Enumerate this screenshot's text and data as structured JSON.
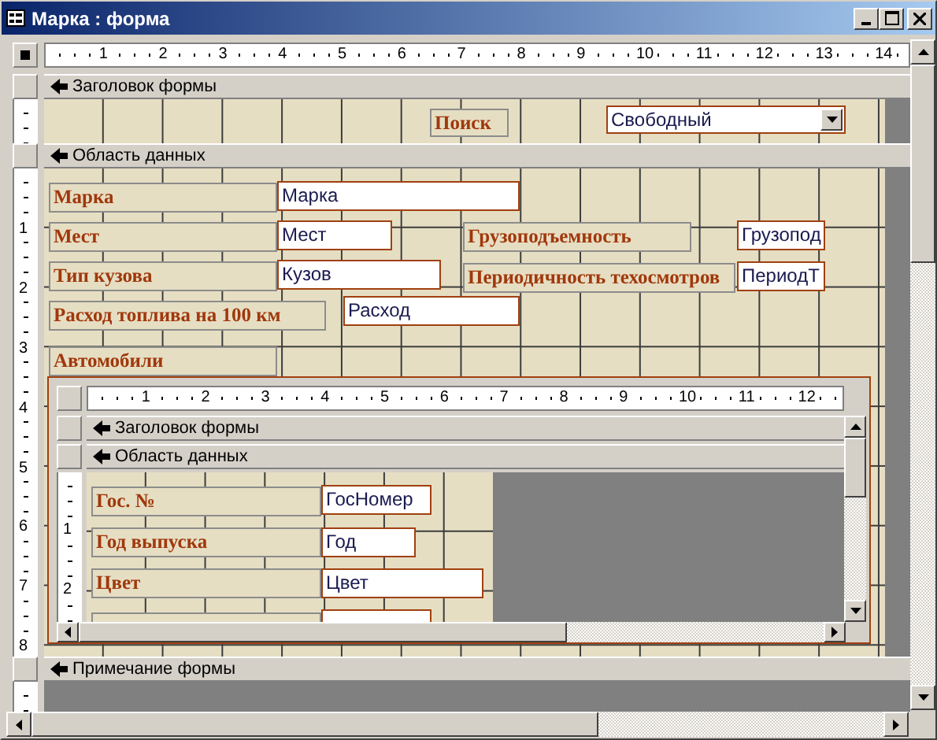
{
  "window": {
    "title": "Марка : форма"
  },
  "ruler": [
    "1",
    "2",
    "3",
    "4",
    "5",
    "6",
    "7",
    "8",
    "9",
    "10",
    "11",
    "12",
    "13",
    "14"
  ],
  "vertical_ruler": [
    "1",
    "2",
    "3",
    "4",
    "5",
    "6",
    "7",
    "8"
  ],
  "form_header": {
    "label": "Заголовок формы",
    "controls": [
      {
        "kind": "label",
        "text": "Поиск"
      },
      {
        "kind": "combo",
        "value": "Свободный"
      }
    ]
  },
  "detail": {
    "label": "Область данных",
    "controls": [
      {
        "kind": "label",
        "text": "Марка"
      },
      {
        "kind": "textbox",
        "text": "Марка"
      },
      {
        "kind": "label",
        "text": "Мест"
      },
      {
        "kind": "textbox",
        "text": "Мест"
      },
      {
        "kind": "label",
        "text": "Грузоподъемность"
      },
      {
        "kind": "textbox",
        "text": "Грузопод"
      },
      {
        "kind": "label",
        "text": "Тип кузова"
      },
      {
        "kind": "textbox",
        "text": "Кузов"
      },
      {
        "kind": "label",
        "text": "Периодичность техосмотров"
      },
      {
        "kind": "textbox",
        "text": "ПериодТ"
      },
      {
        "kind": "label",
        "text": "Расход топлива на 100 км"
      },
      {
        "kind": "textbox",
        "text": "Расход"
      },
      {
        "kind": "label",
        "text": "Автомобили"
      }
    ],
    "subform": {
      "ruler": [
        "1",
        "2",
        "3",
        "4",
        "5",
        "6",
        "7",
        "8",
        "9",
        "10",
        "11",
        "12"
      ],
      "vertical_ruler": [
        "1",
        "2"
      ],
      "header_label": "Заголовок формы",
      "detail_label": "Область данных",
      "controls": [
        {
          "kind": "label",
          "text": "Гос. №"
        },
        {
          "kind": "textbox",
          "text": "ГосНомер"
        },
        {
          "kind": "label",
          "text": "Год выпуска"
        },
        {
          "kind": "textbox",
          "text": "Год"
        },
        {
          "kind": "label",
          "text": "Цвет"
        },
        {
          "kind": "textbox",
          "text": "Цвет"
        }
      ]
    }
  },
  "form_footer": {
    "label": "Примечание формы"
  }
}
